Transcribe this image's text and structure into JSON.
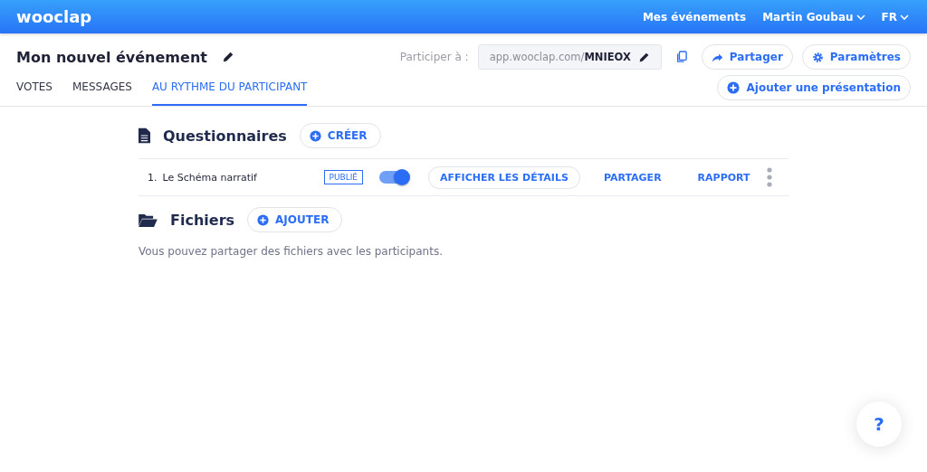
{
  "header": {
    "logo": "wooclap",
    "nav": [
      {
        "label": "Mes événements",
        "dropdown": false
      },
      {
        "label": "Martin Goubau",
        "dropdown": true
      },
      {
        "label": "FR",
        "dropdown": true
      }
    ]
  },
  "event": {
    "title": "Mon nouvel événement",
    "participate_label": "Participer à :",
    "url_prefix": "app.wooclap.com/",
    "code": "MNIEOX",
    "share": "Partager",
    "settings": "Paramètres",
    "add_presentation": "Ajouter une présentation"
  },
  "tabs": [
    {
      "label": "VOTES",
      "selected": false
    },
    {
      "label": "MESSAGES",
      "selected": false
    },
    {
      "label": "AU RYTHME DU PARTICIPANT",
      "selected": true
    }
  ],
  "questionnaires": {
    "title": "Questionnaires",
    "create": "CRÉER",
    "items": [
      {
        "number": "1.",
        "name": "Le Schéma narratif",
        "status": "PUBLIÉ",
        "on": true,
        "details": "AFFICHER LES DÉTAILS",
        "share": "PARTAGER",
        "report": "RAPPORT"
      }
    ]
  },
  "files": {
    "title": "Fichiers",
    "add": "AJOUTER",
    "empty": "Vous pouvez partager des fichiers avec les participants."
  },
  "help": "?"
}
